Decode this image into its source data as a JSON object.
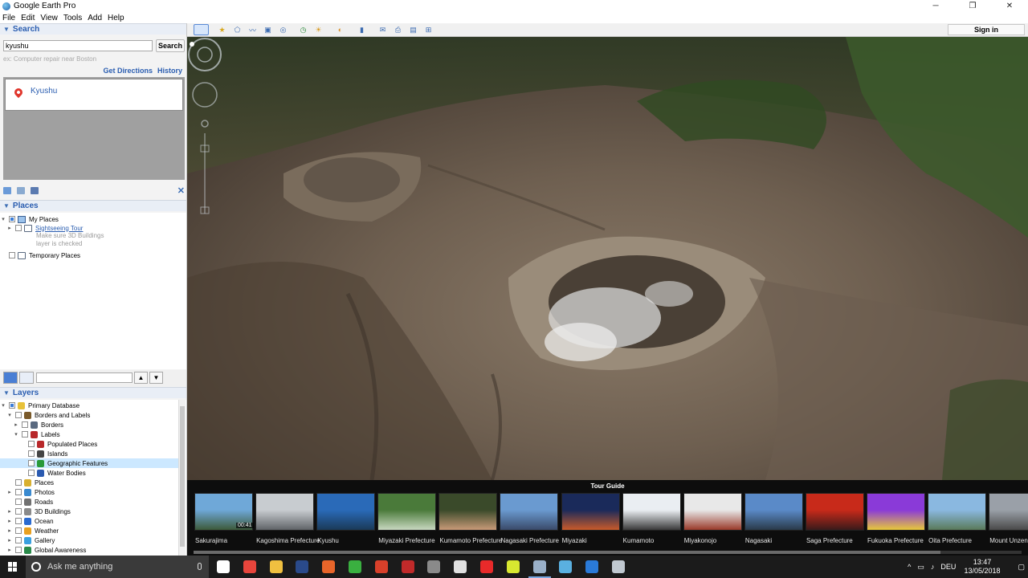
{
  "window": {
    "title": "Google Earth Pro",
    "controls": [
      "─",
      "❐",
      "✕"
    ]
  },
  "menu": [
    "File",
    "Edit",
    "View",
    "Tools",
    "Add",
    "Help"
  ],
  "search": {
    "header": "Search",
    "value": "kyushu",
    "button": "Search",
    "hint": "ex: Computer repair near Boston",
    "get_directions": "Get Directions",
    "history": "History",
    "result": "Kyushu"
  },
  "places": {
    "header": "Places",
    "my_places": "My Places",
    "sightseeing": "Sightseeing Tour",
    "note_line1": "Make sure 3D Buildings",
    "note_line2": "layer is checked",
    "temporary": "Temporary Places"
  },
  "layers": {
    "header": "Layers",
    "items": [
      {
        "label": "Primary Database",
        "indent": 0,
        "expander": "▾",
        "color": "#e8c23a",
        "checked": true
      },
      {
        "label": "Borders and Labels",
        "indent": 1,
        "expander": "▾",
        "color": "#7a5a2a",
        "checked": false
      },
      {
        "label": "Borders",
        "indent": 2,
        "expander": "▸",
        "color": "#5a6a80",
        "checked": false
      },
      {
        "label": "Labels",
        "indent": 2,
        "expander": "▾",
        "color": "#b8282a",
        "checked": false
      },
      {
        "label": "Populated Places",
        "indent": 3,
        "expander": "",
        "color": "#b8282a",
        "checked": false
      },
      {
        "label": "Islands",
        "indent": 3,
        "expander": "",
        "color": "#444444",
        "checked": false
      },
      {
        "label": "Geographic Features",
        "indent": 3,
        "expander": "",
        "color": "#2a9a3a",
        "checked": false,
        "selected": true
      },
      {
        "label": "Water Bodies",
        "indent": 3,
        "expander": "",
        "color": "#2a5ab0",
        "checked": false
      },
      {
        "label": "Places",
        "indent": 1,
        "expander": "",
        "color": "#d8b030",
        "checked": false
      },
      {
        "label": "Photos",
        "indent": 1,
        "expander": "▸",
        "color": "#3a8ad0",
        "checked": false
      },
      {
        "label": "Roads",
        "indent": 1,
        "expander": "",
        "color": "#707070",
        "checked": false
      },
      {
        "label": "3D Buildings",
        "indent": 1,
        "expander": "▸",
        "color": "#8a8a8a",
        "checked": false
      },
      {
        "label": "Ocean",
        "indent": 1,
        "expander": "▸",
        "color": "#2a6ad0",
        "checked": false
      },
      {
        "label": "Weather",
        "indent": 1,
        "expander": "▸",
        "color": "#e8a020",
        "checked": false
      },
      {
        "label": "Gallery",
        "indent": 1,
        "expander": "▸",
        "color": "#3aa0e0",
        "checked": false
      },
      {
        "label": "Global Awareness",
        "indent": 1,
        "expander": "▸",
        "color": "#2a8a4a",
        "checked": false
      }
    ]
  },
  "toolbar": {
    "sign_in": "Sign in"
  },
  "tour": {
    "title": "Tour Guide",
    "items": [
      {
        "caption": "Sakurajima",
        "duration": "00:41",
        "colors": [
          "#6fa8d8",
          "#3d5a3a"
        ]
      },
      {
        "caption": "Kagoshima Prefecture",
        "duration": "",
        "colors": [
          "#c8ccd0",
          "#606468"
        ]
      },
      {
        "caption": "Kyushu",
        "duration": "",
        "colors": [
          "#2a6ab8",
          "#1a3a58"
        ]
      },
      {
        "caption": "Miyazaki Prefecture",
        "duration": "",
        "colors": [
          "#4a7a3a",
          "#c8d8c0"
        ]
      },
      {
        "caption": "Kumamoto Prefecture",
        "duration": "",
        "colors": [
          "#3a4a2a",
          "#c89a78"
        ]
      },
      {
        "caption": "Nagasaki Prefecture",
        "duration": "",
        "colors": [
          "#6a9ad0",
          "#3a4a6a"
        ]
      },
      {
        "caption": "Miyazaki",
        "duration": "",
        "colors": [
          "#1a2a5a",
          "#c85a2a"
        ]
      },
      {
        "caption": "Kumamoto",
        "duration": "",
        "colors": [
          "#eaeef2",
          "#3a3a3a"
        ]
      },
      {
        "caption": "Miyakonojo",
        "duration": "",
        "colors": [
          "#e8e8e8",
          "#9a3a2a"
        ]
      },
      {
        "caption": "Nagasaki",
        "duration": "",
        "colors": [
          "#5a8ac8",
          "#2a3a4a"
        ]
      },
      {
        "caption": "Saga Prefecture",
        "duration": "",
        "colors": [
          "#c82a1a",
          "#3a1a1a"
        ]
      },
      {
        "caption": "Fukuoka Prefecture",
        "duration": "",
        "colors": [
          "#8a3ad8",
          "#e8c83a"
        ]
      },
      {
        "caption": "Oita Prefecture",
        "duration": "",
        "colors": [
          "#8ab8e0",
          "#5a7a5a"
        ]
      },
      {
        "caption": "Mount Unzen",
        "duration": "",
        "colors": [
          "#9aa0a8",
          "#4a4a4a"
        ]
      }
    ]
  },
  "taskbar": {
    "search_placeholder": "Ask me anything",
    "language": "DEU",
    "time": "13:47",
    "date": "13/05/2018",
    "apps": [
      {
        "name": "task-view-icon",
        "color": "#ffffff"
      },
      {
        "name": "chrome-icon",
        "color": "#e8453c"
      },
      {
        "name": "file-explorer-icon",
        "color": "#f0c040"
      },
      {
        "name": "steam-icon",
        "color": "#2a4a8a"
      },
      {
        "name": "app-orange-icon",
        "color": "#e8652a"
      },
      {
        "name": "app-green-icon",
        "color": "#3ab040"
      },
      {
        "name": "app-red-icon",
        "color": "#d8402a"
      },
      {
        "name": "app-bug-icon",
        "color": "#c02a2a"
      },
      {
        "name": "app-gray-icon",
        "color": "#8a8a8a"
      },
      {
        "name": "app-white-icon",
        "color": "#e0e0e0"
      },
      {
        "name": "app-star-icon",
        "color": "#e82a2a"
      },
      {
        "name": "app-g-icon",
        "color": "#d8e830"
      },
      {
        "name": "google-earth-icon",
        "color": "#9ab0c8",
        "active": true
      },
      {
        "name": "app-teal-icon",
        "color": "#5ab0e0"
      },
      {
        "name": "edge-icon",
        "color": "#2a7ad8"
      },
      {
        "name": "app-monitor-icon",
        "color": "#c0c8d0"
      }
    ]
  }
}
